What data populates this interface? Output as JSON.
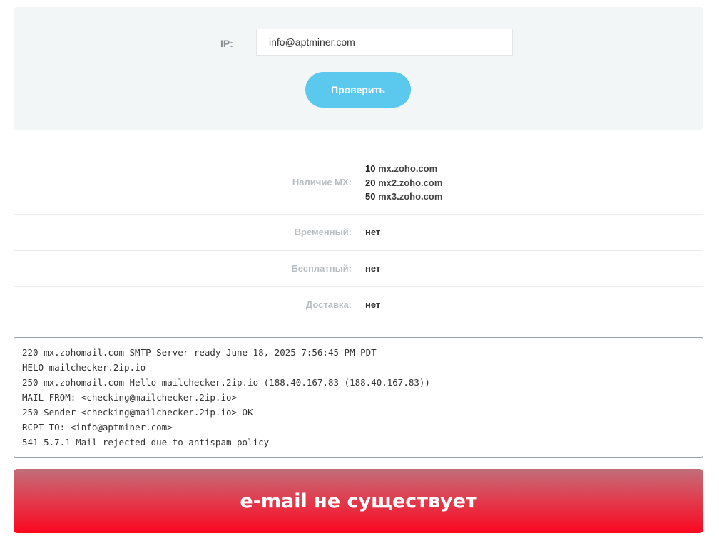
{
  "form": {
    "ip_label": "IP:",
    "input_value": "info@aptminer.com",
    "check_button_label": "Проверить"
  },
  "results": {
    "mx": {
      "label": "Наличие MX:",
      "records": [
        {
          "pref": "10",
          "host": "mx.zoho.com"
        },
        {
          "pref": "20",
          "host": "mx2.zoho.com"
        },
        {
          "pref": "50",
          "host": "mx3.zoho.com"
        }
      ]
    },
    "temporary": {
      "label": "Временный:",
      "value": "нет"
    },
    "free": {
      "label": "Бесплатный:",
      "value": "нет"
    },
    "delivery": {
      "label": "Доставка:",
      "value": "нет"
    }
  },
  "smtp_log": {
    "lines": [
      "220 mx.zohomail.com SMTP Server ready June 18, 2025 7:56:45 PM PDT",
      "HELO mailchecker.2ip.io",
      "250 mx.zohomail.com Hello mailchecker.2ip.io (188.40.167.83 (188.40.167.83))",
      "MAIL FROM: <checking@mailchecker.2ip.io>",
      "250 Sender <checking@mailchecker.2ip.io> OK",
      "RCPT TO: <info@aptminer.com>",
      "541 5.7.1 Mail rejected due to antispam policy"
    ]
  },
  "result_banner": {
    "text": "e-mail не существует",
    "color_top": "#c06f7a",
    "color_bottom": "#fb0720"
  },
  "colors": {
    "accent_button": "#5bc8ee",
    "panel_bg": "#f3f6f7"
  }
}
